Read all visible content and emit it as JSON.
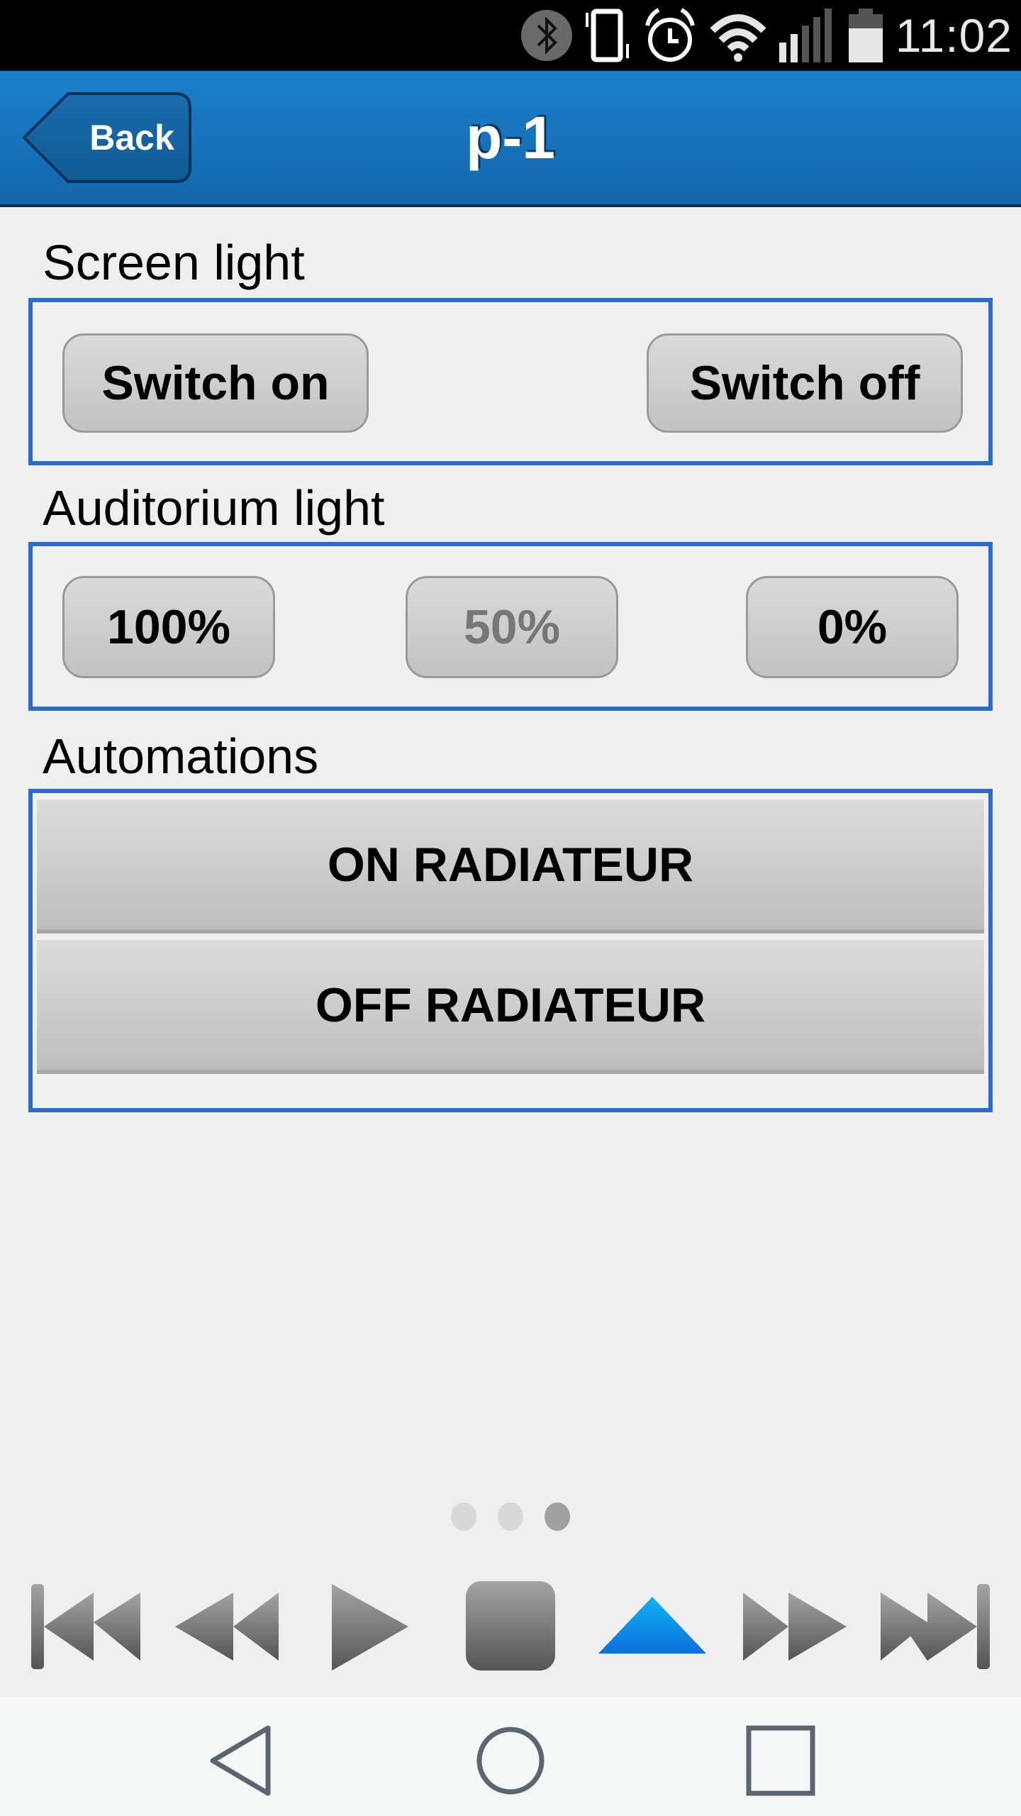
{
  "status_bar": {
    "time": "11:02",
    "icons": [
      "bluetooth-icon",
      "vibrate-icon",
      "alarm-icon",
      "wifi-icon",
      "signal-icon",
      "battery-icon"
    ]
  },
  "header": {
    "back_label": "Back",
    "title": "p-1",
    "color": "#1872bd"
  },
  "sections": {
    "screen_light": {
      "label": "Screen light",
      "buttons": [
        {
          "label": "Switch on",
          "enabled": true
        },
        {
          "label": "Switch off",
          "enabled": true
        }
      ]
    },
    "auditorium_light": {
      "label": "Auditorium light",
      "buttons": [
        {
          "label": "100%",
          "enabled": true
        },
        {
          "label": "50%",
          "enabled": false
        },
        {
          "label": "0%",
          "enabled": true
        }
      ]
    },
    "automations": {
      "label": "Automations",
      "buttons": [
        {
          "label": "ON RADIATEUR"
        },
        {
          "label": "OFF RADIATEUR"
        }
      ]
    }
  },
  "pager": {
    "total_pages": 3,
    "current_page": 3
  },
  "media_controls": [
    "skip-to-start-icon",
    "rewind-icon",
    "play-icon",
    "stop-icon",
    "eject-icon",
    "fast-forward-icon",
    "skip-to-end-icon"
  ],
  "accent_color": "#2d6bc9",
  "active_media_color": "#0e86e6",
  "nav_bar": [
    "back-nav-icon",
    "home-nav-icon",
    "recents-nav-icon"
  ]
}
